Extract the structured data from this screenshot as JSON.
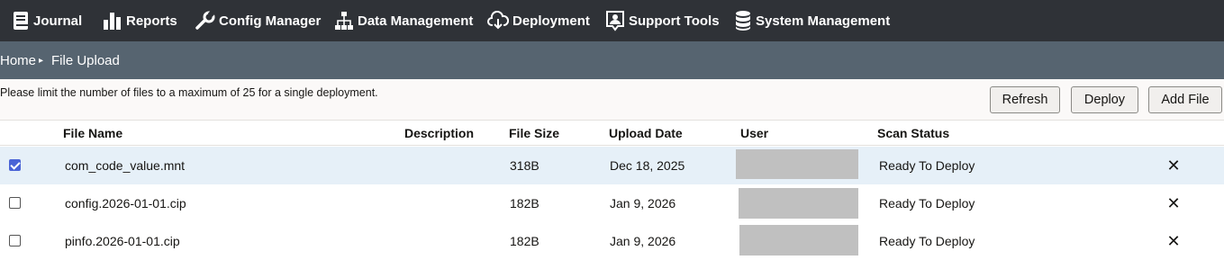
{
  "nav": {
    "items": [
      {
        "label": "Journal",
        "icon": "book-icon"
      },
      {
        "label": "Reports",
        "icon": "bar-chart-icon"
      },
      {
        "label": "Config Manager",
        "icon": "wrench-icon"
      },
      {
        "label": "Data Management",
        "icon": "hierarchy-icon"
      },
      {
        "label": "Deployment",
        "icon": "cloud-download-icon"
      },
      {
        "label": "Support Tools",
        "icon": "support-person-icon"
      },
      {
        "label": "System Management",
        "icon": "database-icon"
      }
    ]
  },
  "breadcrumb": {
    "home": "Home",
    "separator": "▸",
    "current": "File Upload"
  },
  "toolbar": {
    "notice": "Please limit the number of files to a maximum of 25 for a single deployment.",
    "refresh_label": "Refresh",
    "deploy_label": "Deploy",
    "add_file_label": "Add File"
  },
  "table": {
    "headers": {
      "file_name": "File Name",
      "description": "Description",
      "file_size": "File Size",
      "upload_date": "Upload Date",
      "user": "User",
      "scan_status": "Scan Status"
    },
    "rows": [
      {
        "checked": true,
        "file_name": "com_code_value.mnt",
        "description": "",
        "file_size": "318B",
        "upload_date": "Dec 18, 2025",
        "user": "",
        "scan_status": "Ready To Deploy",
        "delete_glyph": "✕"
      },
      {
        "checked": false,
        "file_name": "config.2026-01-01.cip",
        "description": "",
        "file_size": "182B",
        "upload_date": "Jan 9, 2026",
        "user": "",
        "scan_status": "Ready To Deploy",
        "delete_glyph": "✕"
      },
      {
        "checked": false,
        "file_name": "pinfo.2026-01-01.cip",
        "description": "",
        "file_size": "182B",
        "upload_date": "Jan 9, 2026",
        "user": "",
        "scan_status": "Ready To Deploy",
        "delete_glyph": "✕"
      }
    ]
  },
  "colors": {
    "nav_bg": "#2f3237",
    "breadcrumb_bg": "#566470",
    "selected_row_bg": "#e6f0f8",
    "checkbox_accent": "#4a63d6",
    "user_redaction": "#c0c0c0"
  }
}
